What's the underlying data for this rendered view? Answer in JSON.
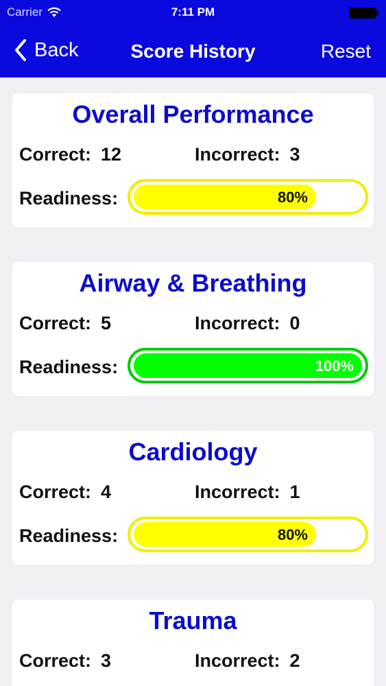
{
  "status_bar": {
    "carrier": "Carrier",
    "time": "7:11 PM"
  },
  "nav": {
    "back_label": "Back",
    "title": "Score History",
    "reset_label": "Reset"
  },
  "labels": {
    "correct": "Correct:",
    "incorrect": "Incorrect:",
    "readiness": "Readiness:"
  },
  "colors": {
    "header": "#0a0adf",
    "title_text": "#0c0ccc",
    "bar_yellow": "#ffff00",
    "bar_yellow_border": "#f2ee00",
    "bar_green": "#00ff00",
    "bar_green_border": "#00cc00"
  },
  "cards": [
    {
      "title": "Overall Performance",
      "correct": "12",
      "incorrect": "3",
      "readiness": "80%",
      "readiness_fraction": 0.8,
      "bar_color": "yellow"
    },
    {
      "title": "Airway & Breathing",
      "correct": "5",
      "incorrect": "0",
      "readiness": "100%",
      "readiness_fraction": 1.0,
      "bar_color": "green"
    },
    {
      "title": "Cardiology",
      "correct": "4",
      "incorrect": "1",
      "readiness": "80%",
      "readiness_fraction": 0.8,
      "bar_color": "yellow"
    },
    {
      "title": "Trauma",
      "correct": "3",
      "incorrect": "2"
    }
  ]
}
